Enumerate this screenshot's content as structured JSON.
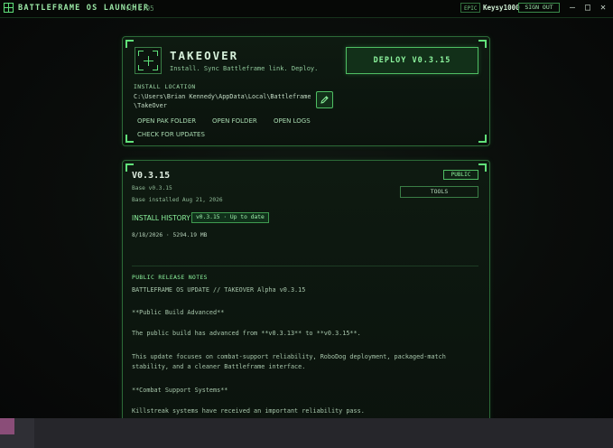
{
  "titlebar": {
    "app_title": "BATTLEFRAME OS LAUNCHER",
    "version": "v0.1.95",
    "account_type": "EPIC",
    "user_name": "Keysy1000",
    "signout_label": "SIGN OUT",
    "minimize_glyph": "—",
    "maximize_glyph": "□",
    "close_glyph": "✕"
  },
  "game": {
    "title": "TAKEOVER",
    "subtitle": "Install. Sync Battleframe link. Deploy.",
    "deploy_label": "DEPLOY V0.3.15",
    "install_location_label": "INSTALL LOCATION",
    "install_path_line1": "C:\\Users\\Brian Kennedy\\AppData\\Local\\Battleframe",
    "install_path_line2": "\\TakeOver",
    "actions": {
      "open_pak": "OPEN PAK FOLDER",
      "open_folder": "OPEN FOLDER",
      "open_logs": "OPEN LOGS",
      "check_updates": "CHECK FOR UPDATES"
    }
  },
  "release": {
    "version": "V0.3.15",
    "base": "Base v0.3.15",
    "base_installed": "Base installed Aug 21, 2026",
    "channel_badge": "PUBLIC",
    "tools_label": "TOOLS",
    "history_label": "INSTALL HISTORY",
    "history_badge": "v0.3.15 · Up to date",
    "history_entry": "8/18/2026  ·  5294.19 MB",
    "notes_label": "PUBLIC RELEASE NOTES",
    "notes": [
      "BATTLEFRAME OS UPDATE // TAKEOVER Alpha v0.3.15",
      "**Public Build Advanced**",
      "The public build has advanced from **v0.3.13** to **v0.3.15**.",
      "This update focuses on combat-support reliability, RoboDog deployment, packaged-match",
      "stability, and a cleaner Battleframe interface.",
      "**Combat Support Systems**",
      "Killstreak systems have received an important reliability pass."
    ]
  },
  "colors": {
    "accent": "#5fe07a",
    "panel_border": "#2c6a37",
    "background": "#070908"
  },
  "icons": [
    "app-logo-icon",
    "game-logo-icon",
    "edit-pencil-icon"
  ]
}
